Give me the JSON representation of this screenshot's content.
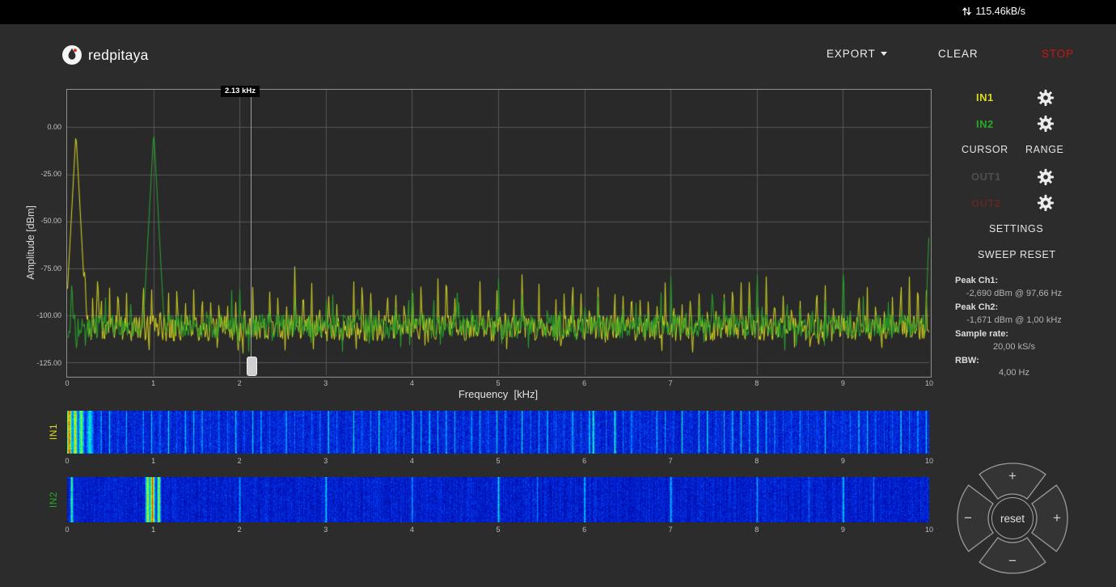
{
  "colors": {
    "page_bg": "#2c2c2c",
    "statusbar_bg": "#000000",
    "plot_bg": "#292929",
    "plot_border": "#8f8f8f",
    "grid": "#565656",
    "in1": "#d9d922",
    "in2": "#28a828",
    "out1_dim": "#4e4e4e",
    "out2_dim": "#5e2828",
    "stop_red": "#cc1414",
    "cursor": "#9f9f9f"
  },
  "statusbar": {
    "network_speed": "115.46kB/s"
  },
  "header": {
    "logo_text": "redpitaya",
    "export_label": "EXPORT",
    "clear_label": "CLEAR",
    "stop_label": "STOP"
  },
  "sidebar": {
    "in1_label": "IN1",
    "in2_label": "IN2",
    "cursor_label": "CURSOR",
    "range_label": "RANGE",
    "out1_label": "OUT1",
    "out2_label": "OUT2",
    "settings_label": "SETTINGS",
    "sweep_reset_label": "SWEEP RESET",
    "stats": [
      {
        "label": "Peak Ch1:",
        "value": "-2,690 dBm @ 97,66 Hz"
      },
      {
        "label": "Peak Ch2:",
        "value": "-1,671 dBm @ 1,00 kHz"
      },
      {
        "label": "Sample rate:",
        "value": "20,00 kS/s"
      },
      {
        "label": "RBW:",
        "value": "4,00 Hz"
      }
    ]
  },
  "cursor": {
    "label": "2.13 kHz",
    "frequency_khz": 2.13
  },
  "chart_data": {
    "type": "line",
    "title": "",
    "xlabel": "Frequency  [kHz]",
    "ylabel": "Amplitude [dBm]",
    "xlim": [
      0,
      10
    ],
    "ylim": [
      -132,
      20
    ],
    "x_ticks": [
      0,
      1,
      2,
      3,
      4,
      5,
      6,
      7,
      8,
      9,
      10
    ],
    "y_ticks": [
      0,
      -25,
      -50,
      -75,
      -100,
      -125
    ],
    "y_tick_labels": [
      "0.00",
      "-25.00",
      "-50.00",
      "-75.00",
      "-100.00",
      "-125.00"
    ],
    "legend": "off",
    "grid": "on",
    "series": [
      {
        "name": "IN1",
        "color": "#d9d922",
        "seed": 11,
        "noise_floor_dbm": -107,
        "noise_spread_db": 14,
        "fundamental_khz": 0.09766,
        "peak_dbm": -2.69,
        "harmonics": {
          "spacing_khz": 0.09766,
          "from": 2,
          "count": 101,
          "amp_min_dbm": -96,
          "amp_max_dbm": -76
        },
        "extra_spikes": [
          {
            "f": 0.2,
            "dbm": -73
          },
          {
            "f": 0.35,
            "dbm": -78
          }
        ]
      },
      {
        "name": "IN2",
        "color": "#28a828",
        "seed": 77,
        "noise_floor_dbm": -106,
        "noise_spread_db": 13,
        "fundamental_khz": 1.0,
        "peak_dbm": -1.671,
        "harmonics": {
          "spacing_khz": 1.0,
          "from": 2,
          "count": 9,
          "amp_min_dbm": -88,
          "amp_max_dbm": -72
        },
        "harmonics2": {
          "spacing_khz": 0.1465,
          "from": 2,
          "count": 66,
          "amp_min_dbm": -98,
          "amp_max_dbm": -86
        },
        "extra_spikes": [
          {
            "f": 0.05,
            "dbm": -80
          },
          {
            "f": 9.99,
            "dbm": -58
          },
          {
            "f": 4.52,
            "dbm": -86
          },
          {
            "f": 7.48,
            "dbm": -84
          }
        ]
      }
    ]
  },
  "waterfalls": [
    {
      "label": "IN1",
      "seed": 5,
      "base": 0.22,
      "pixel_noise": 0.18,
      "ticks": [
        0,
        1,
        2,
        3,
        4,
        5,
        6,
        7,
        8,
        9,
        10
      ],
      "bands": [
        {
          "f": 0.02,
          "w": 0.05,
          "s": 1.0
        },
        {
          "f": 0.09,
          "w": 0.04,
          "s": 0.92
        },
        {
          "f": 0.16,
          "w": 0.05,
          "s": 0.78
        },
        {
          "f": 0.26,
          "w": 0.07,
          "s": 0.6
        }
      ],
      "harmonic_lines": {
        "spacing_khz": 0.09766,
        "from": 4,
        "count": 98,
        "w": 0.015,
        "s_min": 0.3,
        "s_max": 0.62
      },
      "extra_lines": [
        {
          "f": 6.1,
          "w": 0.02,
          "s": 0.7
        },
        {
          "f": 6.35,
          "w": 0.02,
          "s": 0.65
        }
      ]
    },
    {
      "label": "IN2",
      "seed": 9,
      "base": 0.2,
      "pixel_noise": 0.16,
      "ticks": [
        0,
        1,
        2,
        3,
        4,
        5,
        6,
        7,
        8,
        9,
        10
      ],
      "bands": [
        {
          "f": 0.05,
          "w": 0.025,
          "s": 0.72
        },
        {
          "f": 0.93,
          "w": 0.04,
          "s": 0.85
        },
        {
          "f": 0.985,
          "w": 0.045,
          "s": 1.0
        },
        {
          "f": 1.06,
          "w": 0.035,
          "s": 0.8
        }
      ],
      "harmonic_lines": {
        "spacing_khz": 1.0,
        "from": 2,
        "count": 8,
        "w": 0.02,
        "s_min": 0.45,
        "s_max": 0.6
      },
      "extra_lines": [
        {
          "f": 5.45,
          "w": 0.015,
          "s": 0.4
        },
        {
          "f": 8.6,
          "w": 0.015,
          "s": 0.42
        },
        {
          "f": 9.35,
          "w": 0.015,
          "s": 0.45
        }
      ]
    }
  ],
  "joystick": {
    "up_label": "+",
    "down_label": "−",
    "left_label": "−",
    "right_label": "+",
    "reset_label": "reset"
  }
}
